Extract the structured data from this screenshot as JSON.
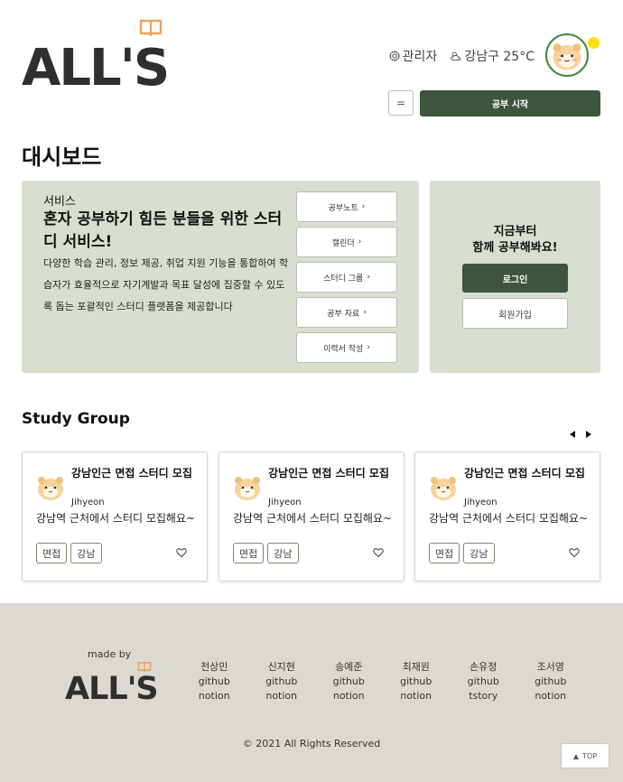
{
  "header": {
    "logo_text": "ALL'S",
    "admin_label": "관리자",
    "weather_label": "강남구 25°C",
    "menu_label": "=",
    "start_label": "공부 시작"
  },
  "page_title": "대시보드",
  "service": {
    "tag": "서비스",
    "headline": "혼자 공부하기 힘든 분들을 위한 스터디 서비스!",
    "description": "다양한 학습 관리, 정보 제공, 취업 지원 기능을 통합하여 학습자가 효율적으로 자기계발과 목표 달성에 집중할 수 있도록 돕는 포괄적인 스터디 플랫폼을 제공합니다",
    "links": [
      {
        "label": "공부노트"
      },
      {
        "label": "캘린더"
      },
      {
        "label": "스터디 그룹"
      },
      {
        "label": "공부 자료"
      },
      {
        "label": "이력서 작성"
      }
    ]
  },
  "login_panel": {
    "line1": "지금부터",
    "line2": "함께 공부해봐요!",
    "login_label": "로그인",
    "signup_label": "회원가입"
  },
  "study_group": {
    "title": "Study Group",
    "cards": [
      {
        "title": "강남인근 면접 스터디 모집",
        "author": "Jihyeon",
        "description": "강남역 근처에서 스터디 모집해요~",
        "tags": [
          "면접",
          "강남"
        ]
      },
      {
        "title": "강남인근 면접 스터디 모집",
        "author": "Jihyeon",
        "description": "강남역 근처에서 스터디 모집해요~",
        "tags": [
          "면접",
          "강남"
        ]
      },
      {
        "title": "강남인근 면접 스터디 모집",
        "author": "Jihyeon",
        "description": "강남역 근처에서 스터디 모집해요~",
        "tags": [
          "면접",
          "강남"
        ]
      }
    ]
  },
  "footer": {
    "made_by": "made by",
    "logo_text": "ALL'S",
    "members": [
      {
        "name": "전상민",
        "link1": "github",
        "link2": "notion"
      },
      {
        "name": "신지현",
        "link1": "github",
        "link2": "notion"
      },
      {
        "name": "송예준",
        "link1": "github",
        "link2": "notion"
      },
      {
        "name": "최재원",
        "link1": "github",
        "link2": "notion"
      },
      {
        "name": "손유정",
        "link1": "github",
        "link2": "tstory"
      },
      {
        "name": "조서영",
        "link1": "github",
        "link2": "notion"
      }
    ],
    "copyright": "© 2021 All Rights Reserved",
    "top_label": "TOP"
  },
  "colors": {
    "accent_green": "#3d553c",
    "panel_bg": "#d9dfd0",
    "footer_bg": "#dcdad0",
    "book_orange": "#f0a15a",
    "status_dot": "#ffe014"
  }
}
